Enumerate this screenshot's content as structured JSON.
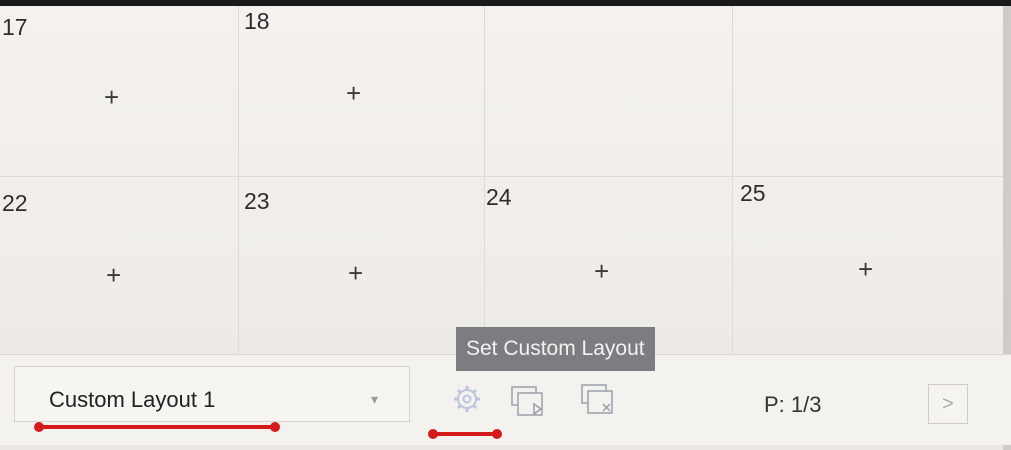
{
  "grid": {
    "cells": [
      {
        "number": "17",
        "plus": "+"
      },
      {
        "number": "18",
        "plus": "+"
      },
      {
        "number": "22",
        "plus": "+"
      },
      {
        "number": "23",
        "plus": "+"
      },
      {
        "number": "24",
        "plus": "+"
      },
      {
        "number": "25",
        "plus": "+"
      }
    ]
  },
  "toolbar": {
    "layout_select_value": "Custom Layout 1",
    "caret": "▾",
    "tooltip": "Set Custom Layout",
    "page_label": "P: 1/3",
    "next_label": ">"
  },
  "icons": {
    "settings": "gear-icon",
    "play_layout": "window-play-icon",
    "delete_layout": "window-delete-icon"
  },
  "colors": {
    "annotation_red": "#d41a1a",
    "tooltip_bg": "#7c7d81"
  }
}
